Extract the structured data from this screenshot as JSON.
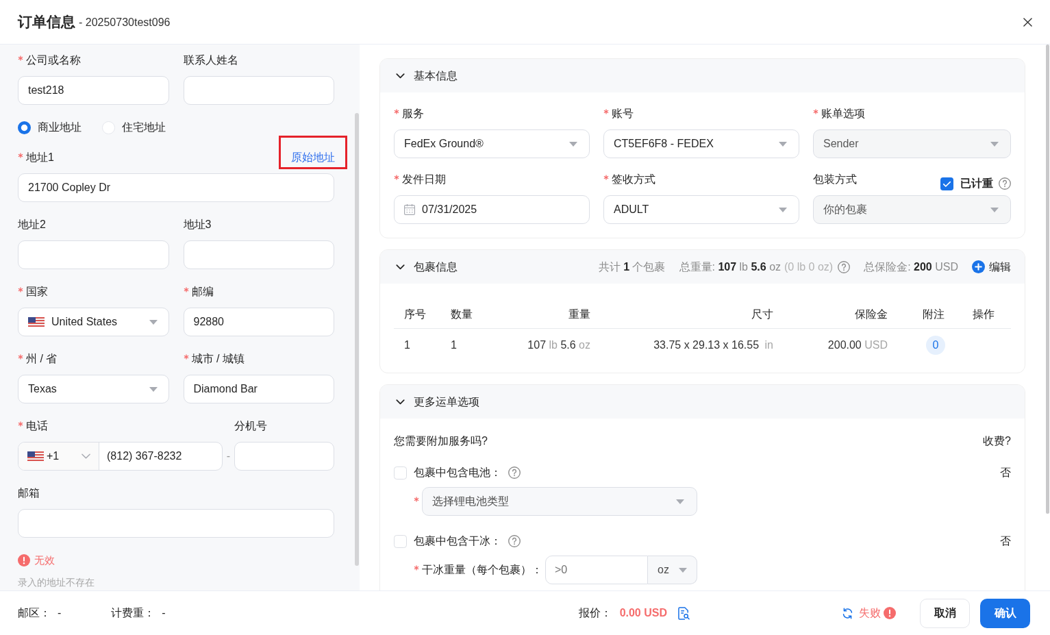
{
  "dialog": {
    "title": "订单信息",
    "subtitle": "- 20250730test096"
  },
  "address_form": {
    "rows": [
      {
        "kind": "fields",
        "fields": [
          {
            "kind": "input",
            "label": "公司或名称",
            "required": true,
            "value": "test218"
          },
          {
            "kind": "input",
            "label": "联系人姓名",
            "required": false
          }
        ]
      },
      {
        "kind": "radio",
        "options": [
          {
            "label": "商业地址",
            "selected": true
          },
          {
            "label": "住宅地址",
            "selected": false
          }
        ]
      },
      {
        "kind": "fields",
        "fields": [
          {
            "kind": "input",
            "label": "地址1",
            "required": true,
            "value": "21700 Copley Dr",
            "link": "原始地址"
          }
        ]
      },
      {
        "kind": "fields",
        "fields": [
          {
            "kind": "input",
            "label": "地址2",
            "required": false
          },
          {
            "kind": "input",
            "label": "地址3",
            "required": false
          }
        ]
      },
      {
        "kind": "fields",
        "fields": [
          {
            "kind": "country",
            "label": "国家",
            "required": true,
            "value": "United States"
          },
          {
            "kind": "input",
            "label": "邮编",
            "required": true,
            "value": "92880"
          }
        ]
      },
      {
        "kind": "fields",
        "fields": [
          {
            "kind": "select",
            "label": "州 / 省",
            "required": true,
            "value": "Texas"
          },
          {
            "kind": "input",
            "label": "城市 / 城镇",
            "required": true,
            "value": "Diamond Bar"
          }
        ]
      },
      {
        "kind": "phone",
        "phone": {
          "label": "电话",
          "required": true,
          "code": "+1",
          "value": "(812) 367-8232"
        },
        "separator": "-",
        "extension": {
          "label": "分机号",
          "required": false
        }
      },
      {
        "kind": "fields",
        "fields": [
          {
            "kind": "input",
            "label": "邮箱",
            "required": false
          }
        ]
      }
    ],
    "validation": {
      "status": "无效",
      "message": "录入的地址不存在"
    }
  },
  "basic_info": {
    "title": "基本信息",
    "expanded": true,
    "fields": [
      {
        "kind": "select",
        "label": "服务",
        "required": true,
        "value": "FedEx Ground®",
        "disabled": false
      },
      {
        "kind": "select",
        "label": "账号",
        "required": true,
        "value": "CT5EF6F8 - FEDEX",
        "disabled": false
      },
      {
        "kind": "select",
        "label": "账单选项",
        "required": true,
        "value": "Sender",
        "disabled": true
      },
      {
        "kind": "date",
        "label": "发件日期",
        "required": true,
        "value": "07/31/2025",
        "disabled": false
      },
      {
        "kind": "select",
        "label": "签收方式",
        "required": true,
        "value": "ADULT",
        "disabled": false
      },
      {
        "kind": "select",
        "label": "包装方式",
        "required": false,
        "value": "你的包裹",
        "disabled": true,
        "checkbox": {
          "label": "已计重",
          "checked": true
        }
      }
    ]
  },
  "package_info": {
    "title": "包裹信息",
    "expanded": true,
    "summary": [
      {
        "text": "共计 **1** 个包裹",
        "help": false
      },
      {
        "text": "总重量: **107** lb **5.6** oz",
        "note": "(0 lb 0 oz)",
        "help": true
      },
      {
        "text": "总保险金: **200** USD",
        "help": false
      }
    ],
    "edit": "编辑",
    "table": {
      "columns": [
        "序号",
        "数量",
        "重量",
        "尺寸",
        "保险金",
        "附注",
        "操作"
      ],
      "rows": [
        {
          "index": "1",
          "quantity": "1",
          "weight": [
            {
              "value": "107",
              "unit": "lb"
            },
            {
              "value": "5.6",
              "unit": "oz"
            }
          ],
          "dimensions": {
            "value": "33.75 x 29.13 x 16.55",
            "unit": "in"
          },
          "insurance": {
            "value": "200.00",
            "unit": "USD"
          },
          "notes": "0"
        }
      ]
    }
  },
  "more_options": {
    "title": "更多运单选项",
    "expanded": true,
    "question": "您需要附加服务吗?",
    "fee_header": "收费?",
    "services": [
      {
        "label": "包裹中包含电池：",
        "checked": false,
        "fee": "否",
        "detail": {
          "kind": "select",
          "required": true,
          "placeholder": "选择锂电池类型"
        }
      },
      {
        "label": "包裹中包含干冰：",
        "checked": false,
        "fee": "否",
        "detail": {
          "kind": "weight",
          "required": true,
          "label": "干冰重量（每个包裹）：",
          "placeholder": ">0",
          "unit": "oz"
        }
      }
    ]
  },
  "footer": {
    "info": [
      {
        "label": "邮区：",
        "value": "-"
      },
      {
        "label": "计费重：",
        "value": "-"
      }
    ],
    "quote": {
      "label": "报价：",
      "value": "0.00 USD"
    },
    "status": "失败",
    "buttons": [
      {
        "label": "取消",
        "kind": "secondary"
      },
      {
        "label": "确认",
        "kind": "primary"
      }
    ]
  }
}
